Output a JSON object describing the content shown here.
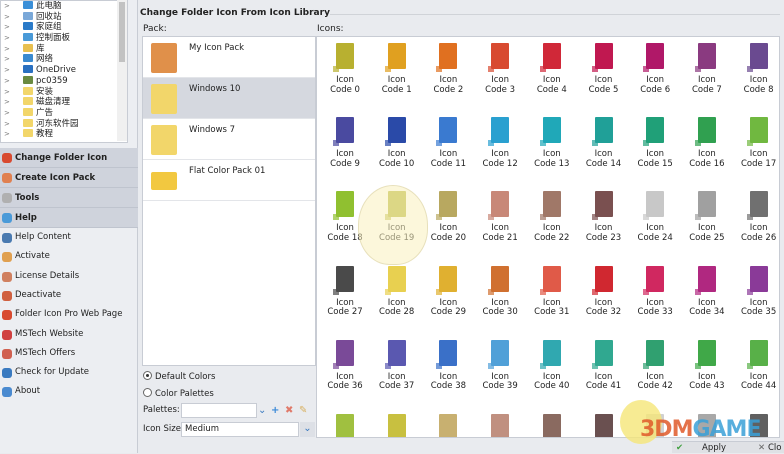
{
  "tree": {
    "items": [
      {
        "label": "此电脑",
        "color": "#3a8fd8"
      },
      {
        "label": "回收站",
        "color": "#7aa8d8"
      },
      {
        "label": "家庭组",
        "color": "#2a7ac8"
      },
      {
        "label": "控制面板",
        "color": "#4a9ad8"
      },
      {
        "label": "库",
        "color": "#e8c050"
      },
      {
        "label": "网络",
        "color": "#3a8ad0"
      },
      {
        "label": "OneDrive",
        "color": "#2a70c0"
      },
      {
        "label": "pc0359",
        "color": "#6a8a40"
      },
      {
        "label": "安装",
        "color": "#f2d66a"
      },
      {
        "label": "磁盘清理",
        "color": "#f2d66a"
      },
      {
        "label": "广告",
        "color": "#f2d66a"
      },
      {
        "label": "河东软件园",
        "color": "#f2d66a"
      },
      {
        "label": "教程",
        "color": "#f2d66a"
      }
    ]
  },
  "accordion": [
    {
      "label": "Change Folder Icon",
      "color": "#d84a30"
    },
    {
      "label": "Create Icon Pack",
      "color": "#e08050"
    },
    {
      "label": "Tools",
      "color": "#b0b0b0"
    },
    {
      "label": "Help",
      "color": "#4a9ad8"
    }
  ],
  "help_items": [
    {
      "label": "Help Content",
      "color": "#4a7ab0"
    },
    {
      "label": "Activate",
      "color": "#e0a050"
    },
    {
      "label": "License Details",
      "color": "#d08060"
    },
    {
      "label": "Deactivate",
      "color": "#d06040"
    },
    {
      "label": "Folder Icon Pro Web Page",
      "color": "#d84a30"
    },
    {
      "label": "MSTech Website",
      "color": "#d04040"
    },
    {
      "label": "MSTech Offers",
      "color": "#d06050"
    },
    {
      "label": "Check for Update",
      "color": "#3a7ac0"
    },
    {
      "label": "About",
      "color": "#4a8ad0"
    }
  ],
  "main": {
    "title": "Change Folder Icon From Icon Library",
    "pack_label": "Pack:",
    "icons_label": "Icons:",
    "packs": [
      {
        "name": "My Icon Pack",
        "selected": false
      },
      {
        "name": "Windows 10",
        "selected": true
      },
      {
        "name": "Windows 7",
        "selected": false
      },
      {
        "name": "Flat Color Pack 01",
        "selected": false
      }
    ],
    "icon_word": "Icon",
    "icons": [
      {
        "code": "Code 0",
        "color": "#b8b030"
      },
      {
        "code": "Code 1",
        "color": "#e0a020"
      },
      {
        "code": "Code 2",
        "color": "#e07020"
      },
      {
        "code": "Code 3",
        "color": "#d84a30"
      },
      {
        "code": "Code 4",
        "color": "#d02838"
      },
      {
        "code": "Code 5",
        "color": "#c01850"
      },
      {
        "code": "Code 6",
        "color": "#b01868"
      },
      {
        "code": "Code 7",
        "color": "#8a3a80"
      },
      {
        "code": "Code 8",
        "color": "#6a4a90"
      },
      {
        "code": "Code 9",
        "color": "#4a4aa0"
      },
      {
        "code": "Code 10",
        "color": "#2a4aa8"
      },
      {
        "code": "Code 11",
        "color": "#3a7ad0"
      },
      {
        "code": "Code 12",
        "color": "#2aa0d0"
      },
      {
        "code": "Code 13",
        "color": "#20a8b8"
      },
      {
        "code": "Code 14",
        "color": "#20a098"
      },
      {
        "code": "Code 15",
        "color": "#20a078"
      },
      {
        "code": "Code 16",
        "color": "#30a050"
      },
      {
        "code": "Code 17",
        "color": "#70b840"
      },
      {
        "code": "Code 18",
        "color": "#90c030"
      },
      {
        "code": "Code 19",
        "color": "#b8b840"
      },
      {
        "code": "Code 20",
        "color": "#b8a860"
      },
      {
        "code": "Code 21",
        "color": "#c88878"
      },
      {
        "code": "Code 22",
        "color": "#a07868"
      },
      {
        "code": "Code 23",
        "color": "#7a5050"
      },
      {
        "code": "Code 24",
        "color": "#c8c8c8"
      },
      {
        "code": "Code 25",
        "color": "#a0a0a0"
      },
      {
        "code": "Code 26",
        "color": "#707070"
      },
      {
        "code": "Code 27",
        "color": "#4a4a4a"
      },
      {
        "code": "Code 28",
        "color": "#e8d050"
      },
      {
        "code": "Code 29",
        "color": "#e0b030"
      },
      {
        "code": "Code 30",
        "color": "#d07030"
      },
      {
        "code": "Code 31",
        "color": "#e05a48"
      },
      {
        "code": "Code 32",
        "color": "#d02830"
      },
      {
        "code": "Code 33",
        "color": "#d02860"
      },
      {
        "code": "Code 34",
        "color": "#b02880"
      },
      {
        "code": "Code 35",
        "color": "#8a3a98"
      },
      {
        "code": "Code 36",
        "color": "#7a4a98"
      },
      {
        "code": "Code 37",
        "color": "#5a58b0"
      },
      {
        "code": "Code 38",
        "color": "#3a70c8"
      },
      {
        "code": "Code 39",
        "color": "#50a0d8"
      },
      {
        "code": "Code 40",
        "color": "#30a8b0"
      },
      {
        "code": "Code 41",
        "color": "#30a890"
      },
      {
        "code": "Code 42",
        "color": "#30a070"
      },
      {
        "code": "Code 43",
        "color": "#40a848"
      },
      {
        "code": "Code 44",
        "color": "#58b048"
      }
    ],
    "partial_row_colors": [
      "#a0c040",
      "#c8c040",
      "#c8b070",
      "#c09080",
      "#8a6a60",
      "#6a5050",
      "#d0d0d0",
      "#a8a8a8",
      "#606060"
    ],
    "default_colors": "Default Colors",
    "color_palettes": "Color Palettes",
    "palettes_label": "Palettes:",
    "palettes_value": "",
    "icon_size_label": "Icon Size:",
    "icon_size_value": "Medium",
    "apply": "Apply",
    "close": "Clo"
  },
  "watermark": {
    "a": "3DM",
    "b": "GAME"
  }
}
